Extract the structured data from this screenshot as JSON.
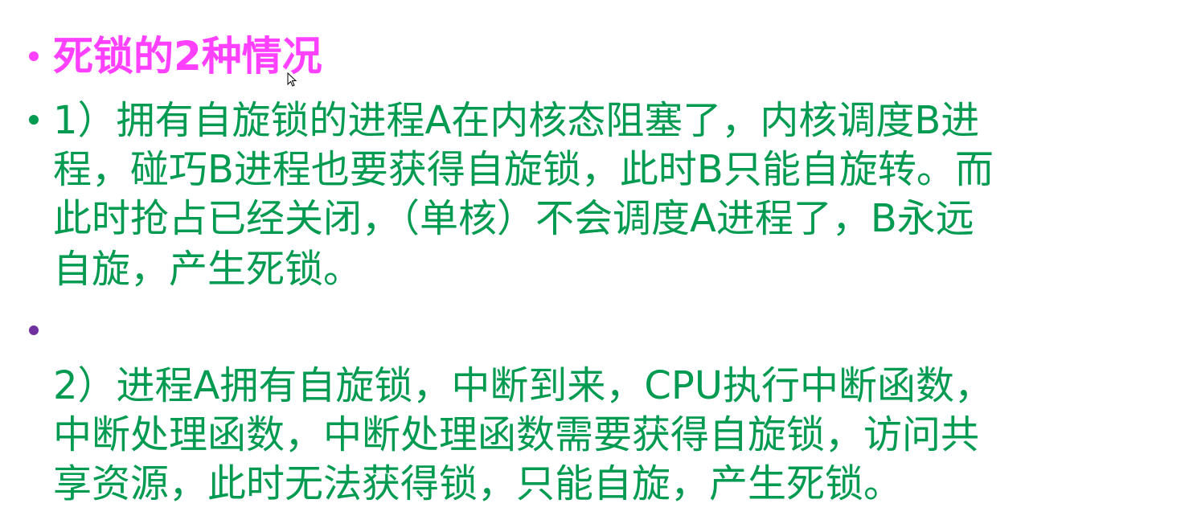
{
  "title": "死锁的2种情况",
  "colors": {
    "title": "#ff40ff",
    "body": "#009a50",
    "bullet_green": "#009a50",
    "bullet_purple": "#7030a0"
  },
  "point1": {
    "lines": [
      "1）拥有自旋锁的进程A在内核态阻塞了，内核调度B进",
      "程，碰巧B进程也要获得自旋锁，此时B只能自旋转。而",
      "此时抢占已经关闭，（单核）不会调度A进程了，B永远",
      "自旋，产生死锁。"
    ]
  },
  "point2": {
    "lines": [
      "2）进程A拥有自旋锁，中断到来，CPU执行中断函数，",
      "中断处理函数，中断处理函数需要获得自旋锁，访问共",
      "享资源，此时无法获得锁，只能自旋，产生死锁。"
    ]
  }
}
